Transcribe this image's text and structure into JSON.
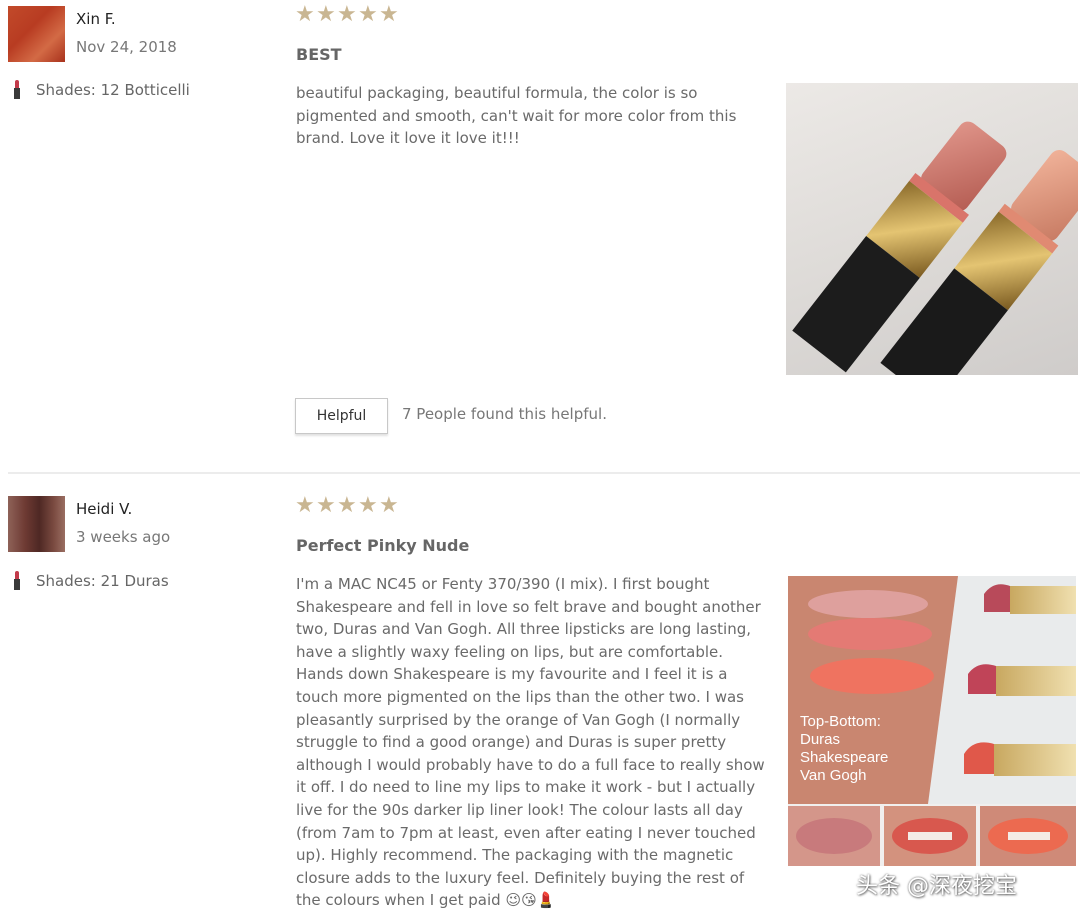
{
  "reviews": [
    {
      "author": "Xin F.",
      "date": "Nov 24, 2018",
      "shade": "Shades: 12 Botticelli",
      "rating": 5,
      "stars": "★★★★★",
      "title": "BEST",
      "body": "beautiful packaging, beautiful formula, the color is so pigmented and smooth, can't wait for more color from this brand. Love it love it love it!!!",
      "helpful_label": "Helpful",
      "helpful_count": "7 People found this helpful."
    },
    {
      "author": "Heidi V.",
      "date": "3 weeks ago",
      "shade": "Shades: 21 Duras",
      "rating": 5,
      "stars": "★★★★★",
      "title": "Perfect Pinky Nude",
      "body": "I'm a MAC NC45 or Fenty 370/390 (I mix). I first bought Shakespeare and fell in love so felt brave and bought another two, Duras and Van Gogh. All three lipsticks are long lasting, have a slightly waxy feeling on lips, but are comfortable. Hands down Shakespeare is my favourite and I feel it is a touch more pigmented on the lips than the other two. I was pleasantly surprised by the orange of Van Gogh (I normally struggle to find a good orange) and Duras is super pretty although I would probably have to do a full face to really show it off. I do need to line my lips to make it work - but I actually live for the 90s darker lip liner look! The colour lasts all day (from 7am to 7pm at least, even after eating I never touched up). Highly recommend. The packaging with the magnetic closure adds to the luxury feel. Definitely buying the rest of the colours when I get paid 😉😘💄",
      "photo_caption": [
        "Top-Bottom:",
        "Duras",
        "Shakespeare",
        "Van Gogh"
      ]
    }
  ],
  "watermark": "头条 @深夜挖宝",
  "colors": {
    "star": "#c9b692",
    "lipstick_gold": "#c9a14a",
    "lipstick_case": "#1e1e1e"
  }
}
